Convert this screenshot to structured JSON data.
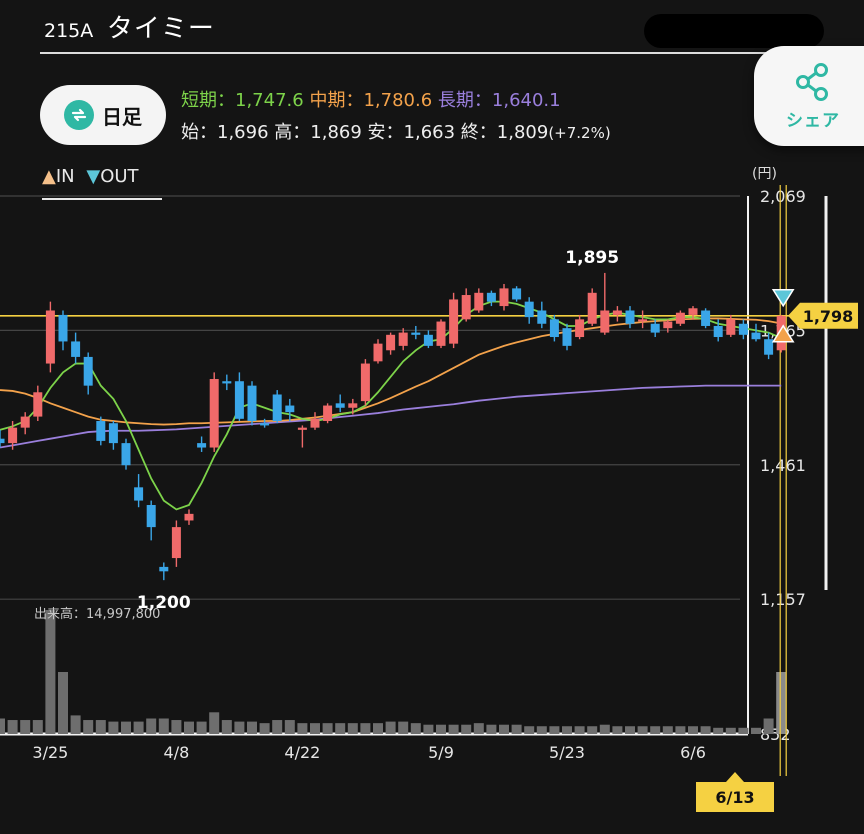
{
  "header": {
    "code": "215A",
    "name": "タイミー"
  },
  "period_button": {
    "label": "日足"
  },
  "share_button": {
    "label": "シェア"
  },
  "moving_averages": [
    {
      "label": "短期",
      "value": "1,747.6",
      "color": "#7dd34a"
    },
    {
      "label": "中期",
      "value": "1,780.6",
      "color": "#f3a24b"
    },
    {
      "label": "長期",
      "value": "1,640.1",
      "color": "#9a7fdc"
    }
  ],
  "ohlc": {
    "open_label": "始",
    "open": "1,696",
    "high_label": "高",
    "high": "1,869",
    "low_label": "安",
    "low": "1,663",
    "close_label": "終",
    "close": "1,809",
    "change": "(+7.2%)"
  },
  "signals": {
    "in_label": "IN",
    "out_label": "OUT",
    "in_color": "#f5c08a",
    "out_color": "#5cc6d8"
  },
  "chart_data": {
    "type": "candlestick",
    "unit": "(円)",
    "y_ticks": [
      "2,069",
      "1,765",
      "1,461",
      "1,157",
      "852"
    ],
    "y_tick_values": [
      2069,
      1765,
      1461,
      1157
    ],
    "ylim": [
      852,
      2069
    ],
    "x_ticks": [
      {
        "label": "3/25",
        "index": 4
      },
      {
        "label": "4/8",
        "index": 14
      },
      {
        "label": "4/22",
        "index": 24
      },
      {
        "label": "5/9",
        "index": 35
      },
      {
        "label": "5/23",
        "index": 45
      },
      {
        "label": "6/6",
        "index": 55
      }
    ],
    "current_price_label": "1,798",
    "current_price": 1798,
    "current_date_label": "6/13",
    "high_annotation": {
      "label": "1,895",
      "value": 1895,
      "index": 47
    },
    "low_annotation": {
      "label": "1,200",
      "value": 1200,
      "index": 13
    },
    "volume_label": "出来高：14,997,800",
    "colors": {
      "up": "#f06a6a",
      "down": "#3aa6e8",
      "short": "#7dd34a",
      "mid": "#f3a24b",
      "long": "#9a7fdc",
      "price_line": "#f5d142"
    },
    "candles": [
      [
        1520,
        1540,
        1500,
        1510
      ],
      [
        1510,
        1560,
        1495,
        1545
      ],
      [
        1545,
        1580,
        1530,
        1570
      ],
      [
        1570,
        1640,
        1560,
        1625
      ],
      [
        1690,
        1830,
        1670,
        1810
      ],
      [
        1800,
        1810,
        1720,
        1740
      ],
      [
        1740,
        1760,
        1690,
        1705
      ],
      [
        1705,
        1715,
        1620,
        1640
      ],
      [
        1560,
        1570,
        1505,
        1515
      ],
      [
        1555,
        1560,
        1495,
        1510
      ],
      [
        1510,
        1520,
        1450,
        1460
      ],
      [
        1410,
        1440,
        1365,
        1380
      ],
      [
        1370,
        1380,
        1290,
        1320
      ],
      [
        1230,
        1240,
        1200,
        1220
      ],
      [
        1250,
        1335,
        1230,
        1320
      ],
      [
        1335,
        1360,
        1325,
        1350
      ],
      [
        1510,
        1525,
        1490,
        1500
      ],
      [
        1500,
        1670,
        1490,
        1655
      ],
      [
        1650,
        1665,
        1630,
        1645
      ],
      [
        1650,
        1670,
        1560,
        1565
      ],
      [
        1640,
        1650,
        1550,
        1560
      ],
      [
        1555,
        1565,
        1545,
        1550
      ],
      [
        1620,
        1630,
        1555,
        1560
      ],
      [
        1595,
        1610,
        1560,
        1580
      ],
      [
        1540,
        1550,
        1500,
        1545
      ],
      [
        1545,
        1580,
        1540,
        1565
      ],
      [
        1560,
        1600,
        1555,
        1595
      ],
      [
        1600,
        1620,
        1580,
        1590
      ],
      [
        1590,
        1610,
        1575,
        1600
      ],
      [
        1605,
        1700,
        1595,
        1690
      ],
      [
        1695,
        1745,
        1690,
        1735
      ],
      [
        1720,
        1760,
        1710,
        1755
      ],
      [
        1730,
        1770,
        1720,
        1760
      ],
      [
        1760,
        1775,
        1745,
        1755
      ],
      [
        1755,
        1765,
        1725,
        1730
      ],
      [
        1730,
        1790,
        1725,
        1785
      ],
      [
        1735,
        1850,
        1725,
        1835
      ],
      [
        1790,
        1860,
        1785,
        1845
      ],
      [
        1810,
        1860,
        1805,
        1850
      ],
      [
        1850,
        1855,
        1820,
        1830
      ],
      [
        1820,
        1870,
        1810,
        1860
      ],
      [
        1860,
        1865,
        1830,
        1835
      ],
      [
        1830,
        1840,
        1780,
        1795
      ],
      [
        1810,
        1830,
        1770,
        1780
      ],
      [
        1790,
        1800,
        1740,
        1750
      ],
      [
        1770,
        1780,
        1720,
        1730
      ],
      [
        1750,
        1800,
        1745,
        1790
      ],
      [
        1780,
        1860,
        1775,
        1850
      ],
      [
        1760,
        1895,
        1755,
        1810
      ],
      [
        1800,
        1820,
        1785,
        1810
      ],
      [
        1810,
        1820,
        1770,
        1780
      ],
      [
        1790,
        1810,
        1770,
        1790
      ],
      [
        1780,
        1790,
        1750,
        1760
      ],
      [
        1770,
        1790,
        1760,
        1785
      ],
      [
        1780,
        1810,
        1775,
        1805
      ],
      [
        1800,
        1820,
        1790,
        1815
      ],
      [
        1810,
        1815,
        1770,
        1775
      ],
      [
        1775,
        1790,
        1740,
        1750
      ],
      [
        1755,
        1800,
        1750,
        1790
      ],
      [
        1780,
        1790,
        1745,
        1755
      ],
      [
        1760,
        1780,
        1740,
        1745
      ],
      [
        1745,
        1760,
        1700,
        1710
      ],
      [
        1720,
        1800,
        1715,
        1798
      ]
    ],
    "ma_short": [
      1540,
      1548,
      1560,
      1590,
      1635,
      1670,
      1690,
      1690,
      1640,
      1610,
      1560,
      1495,
      1430,
      1380,
      1360,
      1370,
      1420,
      1480,
      1530,
      1590,
      1600,
      1590,
      1580,
      1575,
      1565,
      1560,
      1565,
      1575,
      1580,
      1595,
      1625,
      1660,
      1695,
      1720,
      1740,
      1745,
      1770,
      1800,
      1820,
      1830,
      1830,
      1825,
      1815,
      1805,
      1790,
      1775,
      1775,
      1790,
      1800,
      1805,
      1800,
      1795,
      1790,
      1790,
      1795,
      1795,
      1790,
      1780,
      1775,
      1770,
      1765,
      1760,
      1747.6
    ],
    "ma_mid": [
      1630,
      1628,
      1622,
      1612,
      1600,
      1590,
      1580,
      1570,
      1563,
      1560,
      1557,
      1555,
      1553,
      1552,
      1553,
      1555,
      1555,
      1556,
      1557,
      1558,
      1559,
      1560,
      1560,
      1562,
      1565,
      1568,
      1572,
      1576,
      1580,
      1590,
      1600,
      1612,
      1625,
      1638,
      1650,
      1665,
      1680,
      1695,
      1710,
      1720,
      1730,
      1738,
      1745,
      1752,
      1757,
      1762,
      1766,
      1770,
      1774,
      1778,
      1781,
      1784,
      1786,
      1788,
      1790,
      1791,
      1792,
      1792,
      1791,
      1790,
      1789,
      1786,
      1780.6
    ],
    "ma_long": [
      1500,
      1505,
      1510,
      1515,
      1520,
      1525,
      1530,
      1535,
      1537,
      1538,
      1538,
      1538,
      1539,
      1540,
      1541,
      1543,
      1545,
      1547,
      1549,
      1551,
      1553,
      1555,
      1557,
      1559,
      1561,
      1563,
      1566,
      1569,
      1572,
      1575,
      1578,
      1582,
      1586,
      1589,
      1592,
      1595,
      1598,
      1602,
      1606,
      1609,
      1612,
      1615,
      1617,
      1619,
      1621,
      1623,
      1625,
      1627,
      1629,
      1631,
      1633,
      1635,
      1636,
      1637,
      1638,
      1639,
      1640,
      1640,
      1640,
      1640,
      1640,
      1640,
      1640.1
    ],
    "volumes": [
      1.0,
      0.9,
      0.9,
      0.9,
      8.0,
      4.0,
      1.2,
      0.9,
      0.9,
      0.8,
      0.8,
      0.8,
      1.0,
      1.0,
      0.9,
      0.8,
      0.8,
      1.4,
      0.9,
      0.8,
      0.8,
      0.7,
      0.9,
      0.9,
      0.7,
      0.7,
      0.7,
      0.7,
      0.7,
      0.7,
      0.7,
      0.8,
      0.8,
      0.7,
      0.6,
      0.6,
      0.6,
      0.6,
      0.7,
      0.6,
      0.6,
      0.6,
      0.5,
      0.5,
      0.5,
      0.5,
      0.5,
      0.5,
      0.6,
      0.5,
      0.5,
      0.5,
      0.5,
      0.5,
      0.5,
      0.5,
      0.5,
      0.4,
      0.4,
      0.4,
      0.4,
      1.0,
      4.0
    ]
  }
}
